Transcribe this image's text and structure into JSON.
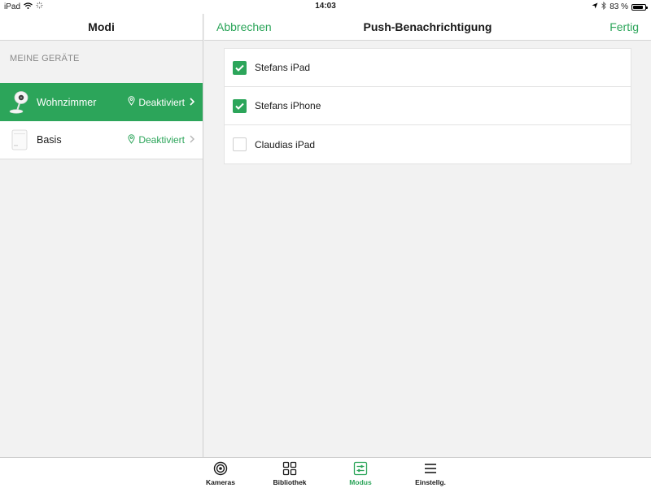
{
  "status_bar": {
    "device": "iPad",
    "time": "14:03",
    "battery": "83 %",
    "battery_level": 0.83
  },
  "left_panel": {
    "title": "Modi",
    "section_label": "MEINE GERÄTE",
    "devices": [
      {
        "name": "Wohnzimmer",
        "status": "Deaktiviert",
        "selected": true
      },
      {
        "name": "Basis",
        "status": "Deaktiviert",
        "selected": false
      }
    ]
  },
  "nav": {
    "cancel_label": "Abbrechen",
    "title": "Push-Benachrichtigung",
    "done_label": "Fertig"
  },
  "recipients": [
    {
      "label": "Stefans iPad",
      "checked": true
    },
    {
      "label": "Stefans iPhone",
      "checked": true
    },
    {
      "label": "Claudias iPad",
      "checked": false
    }
  ],
  "tab_bar": {
    "tabs": [
      {
        "label": "Kameras",
        "icon": "camera-lens-icon",
        "active": false
      },
      {
        "label": "Bibliothek",
        "icon": "grid-icon",
        "active": false
      },
      {
        "label": "Modus",
        "icon": "sliders-icon",
        "active": true
      },
      {
        "label": "Einstellg.",
        "icon": "menu-icon",
        "active": false
      }
    ]
  },
  "colors": {
    "accent": "#2ca55a",
    "background": "#f2f2f2"
  }
}
